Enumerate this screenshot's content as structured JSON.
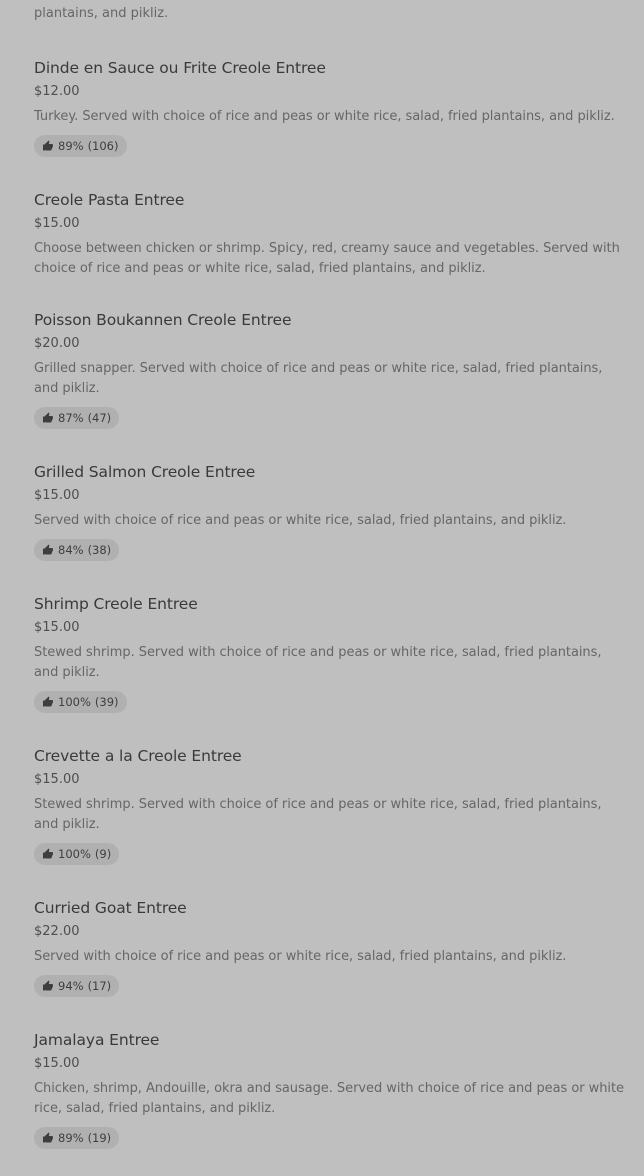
{
  "previous_item_desc": "Okra with beef and crab. Served with choice of rice and peas or white rice, salad, fried plantains, and pikliz.",
  "items": [
    {
      "name": "Dinde en Sauce ou Frite Creole Entree",
      "price": "$12.00",
      "description": "Turkey. Served with choice of rice and peas or white rice, salad, fried plantains, and pikliz.",
      "rating_percent": "89%",
      "rating_count": "(106)"
    },
    {
      "name": "Creole Pasta Entree",
      "price": "$15.00",
      "description": "Choose between chicken or shrimp. Spicy, red, creamy sauce and vegetables. Served with choice of rice and peas or white rice, salad, fried plantains, and pikliz.",
      "rating_percent": "",
      "rating_count": ""
    },
    {
      "name": "Poisson Boukannen Creole Entree",
      "price": "$20.00",
      "description": "Grilled snapper. Served with choice of rice and peas or white rice, salad, fried plantains, and pikliz.",
      "rating_percent": "87%",
      "rating_count": "(47)"
    },
    {
      "name": "Grilled Salmon Creole Entree",
      "price": "$15.00",
      "description": "Served with choice of rice and peas or white rice, salad, fried plantains, and pikliz.",
      "rating_percent": "84%",
      "rating_count": "(38)"
    },
    {
      "name": "Shrimp Creole Entree",
      "price": "$15.00",
      "description": "Stewed shrimp. Served with choice of rice and peas or white rice, salad, fried plantains, and pikliz.",
      "rating_percent": "100%",
      "rating_count": "(39)"
    },
    {
      "name": "Crevette a la Creole Entree",
      "price": "$15.00",
      "description": "Stewed shrimp. Served with choice of rice and peas or white rice, salad, fried plantains, and pikliz.",
      "rating_percent": "100%",
      "rating_count": "(9)"
    },
    {
      "name": "Curried Goat Entree",
      "price": "$22.00",
      "description": "Served with choice of rice and peas or white rice, salad, fried plantains, and pikliz.",
      "rating_percent": "94%",
      "rating_count": "(17)"
    },
    {
      "name": "Jamalaya Entree",
      "price": "$15.00",
      "description": "Chicken, shrimp, Andouille, okra and sausage. Served with choice of rice and peas or white rice, salad, fried plantains, and pikliz.",
      "rating_percent": "89%",
      "rating_count": "(19)"
    }
  ],
  "icons": {
    "rating": "thumbs-up-icon"
  },
  "colors": {
    "background": "#bfbfbf",
    "badge": "#b0b0b0",
    "title": "#3a3a3a",
    "description": "#666666"
  }
}
